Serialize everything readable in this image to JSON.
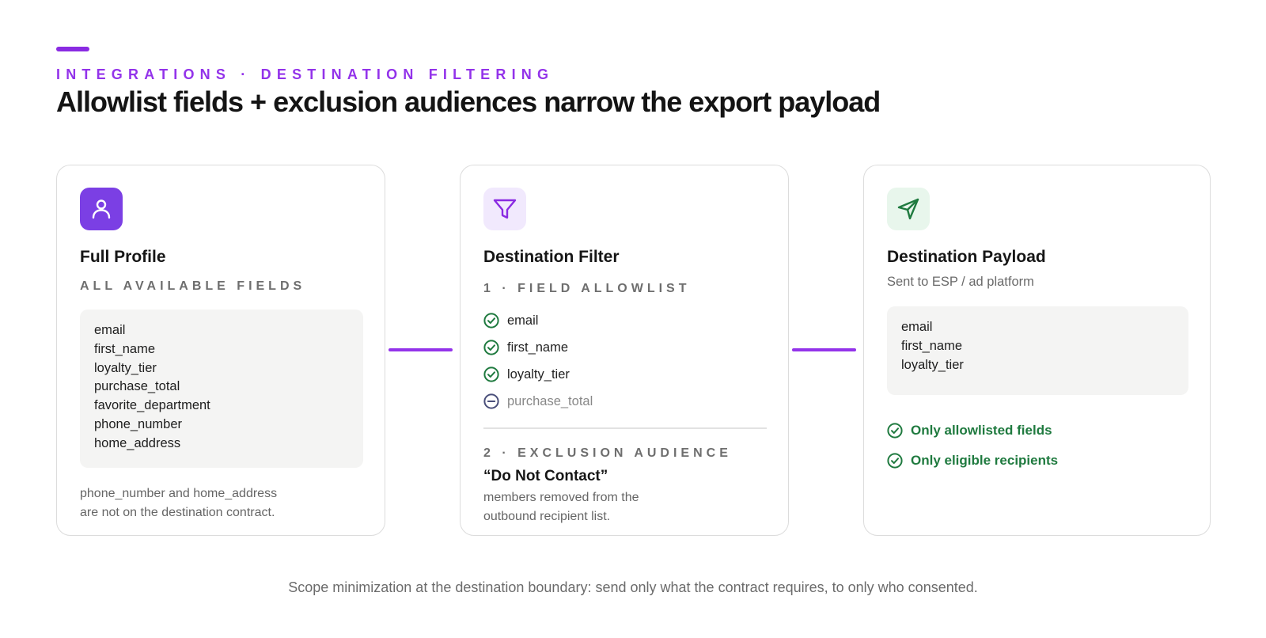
{
  "header": {
    "eyebrow": "INTEGRATIONS · DESTINATION FILTERING",
    "title": "Allowlist fields + exclusion audiences narrow the export payload"
  },
  "colors": {
    "accent": "#9333ea",
    "profile_icon_bg": "#7b3fe4",
    "filter_icon_bg": "#f1e9fd",
    "payload_icon_bg": "#e8f6ec",
    "success": "#1f7a3f",
    "excluded": "#4a4f7a"
  },
  "cards": {
    "profile": {
      "icon": "user-icon",
      "title": "Full Profile",
      "section_label": "ALL AVAILABLE FIELDS",
      "fields": [
        "email",
        "first_name",
        "loyalty_tier",
        "purchase_total",
        "favorite_department",
        "phone_number",
        "home_address"
      ],
      "note_lines": [
        "phone_number and home_address",
        "are not on the destination contract."
      ]
    },
    "filter": {
      "icon": "filter-icon",
      "title": "Destination Filter",
      "allowlist_label": "1 · FIELD ALLOWLIST",
      "allowlist": [
        {
          "name": "email",
          "status": "allowed",
          "icon": "check-circle-icon"
        },
        {
          "name": "first_name",
          "status": "allowed",
          "icon": "check-circle-icon"
        },
        {
          "name": "loyalty_tier",
          "status": "allowed",
          "icon": "check-circle-icon"
        },
        {
          "name": "purchase_total",
          "status": "blocked",
          "icon": "minus-circle-icon"
        }
      ],
      "exclusion_label": "2 · EXCLUSION AUDIENCE",
      "exclusion_title": "“Do Not Contact”",
      "exclusion_note_lines": [
        "members removed from the",
        "outbound recipient list."
      ]
    },
    "payload": {
      "icon": "send-icon",
      "title": "Destination Payload",
      "subtitle": "Sent to ESP / ad platform",
      "fields": [
        "email",
        "first_name",
        "loyalty_tier"
      ],
      "checks": [
        "Only allowlisted fields",
        "Only eligible recipients"
      ]
    }
  },
  "footer": "Scope minimization at the destination boundary: send only what the contract requires, to only who consented."
}
